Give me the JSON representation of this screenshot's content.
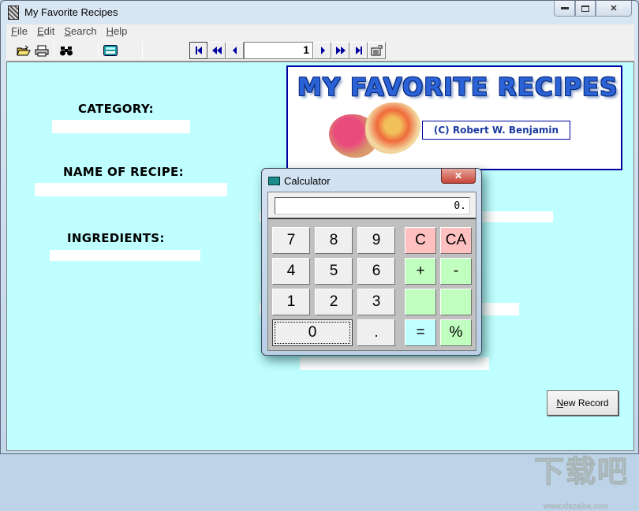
{
  "window": {
    "title": "My Favorite Recipes",
    "icon": "app-icon",
    "controls": {
      "minimize": "—",
      "maximize": "□",
      "close": "✕"
    }
  },
  "menu": [
    {
      "label": "File",
      "mnemonic": "F",
      "rest": "ile"
    },
    {
      "label": "Edit",
      "mnemonic": "E",
      "rest": "dit"
    },
    {
      "label": "Search",
      "mnemonic": "S",
      "rest": "earch"
    },
    {
      "label": "Help",
      "mnemonic": "H",
      "rest": "elp"
    }
  ],
  "toolbar": {
    "icons": [
      "open-folder-icon",
      "print-icon",
      "find-binoculars-icon",
      "calculator-icon"
    ],
    "glyphs": {
      "open": "📂",
      "print": "🖶",
      "find": "🔭",
      "calc": "▦"
    },
    "navigation": {
      "first": "⏮",
      "prev_page": "◀◀",
      "prev": "◀",
      "record_number": "1",
      "next": "▶",
      "next_page": "▶▶",
      "last": "⏭",
      "edit": "✎"
    }
  },
  "form": {
    "category_label": "CATEGORY:",
    "category_value": "",
    "recipe_name_label": "NAME OF RECIPE:",
    "recipe_name_value": "",
    "ingredients_label": "INGREDIENTS:",
    "ingredients_value": ""
  },
  "banner": {
    "title": "MY FAVORITE RECIPES",
    "copyright": "(C) Robert W. Benjamin"
  },
  "buttons": {
    "new_record": "New Record",
    "new_record_mnemonic": "N",
    "new_record_rest": "ew Record"
  },
  "calculator": {
    "title": "Calculator",
    "close": "✕",
    "display": "0.",
    "keys": [
      {
        "label": "7",
        "style": "normal"
      },
      {
        "label": "8",
        "style": "normal"
      },
      {
        "label": "9",
        "style": "normal"
      },
      {
        "label": "C",
        "style": "red"
      },
      {
        "label": "CA",
        "style": "red"
      },
      {
        "label": "4",
        "style": "normal"
      },
      {
        "label": "5",
        "style": "normal"
      },
      {
        "label": "6",
        "style": "normal"
      },
      {
        "label": "+",
        "style": "green"
      },
      {
        "label": "-",
        "style": "green"
      },
      {
        "label": "1",
        "style": "normal"
      },
      {
        "label": "2",
        "style": "normal"
      },
      {
        "label": "3",
        "style": "normal"
      },
      {
        "label": "",
        "style": "green"
      },
      {
        "label": "",
        "style": "green"
      },
      {
        "label": "0",
        "style": "zero"
      },
      {
        "label": ".",
        "style": "normal"
      },
      {
        "label": "=",
        "style": "cyan"
      },
      {
        "label": "%",
        "style": "green"
      }
    ]
  },
  "watermark": {
    "text": "下载吧",
    "url": "www.xiazaiba.com"
  },
  "colors": {
    "client_bg": "#bfffff",
    "banner_border": "#0000a0",
    "banner_title": "#2b62d6"
  }
}
